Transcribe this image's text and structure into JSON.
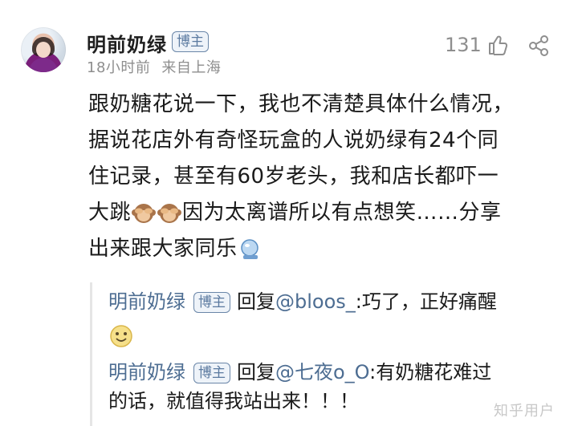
{
  "post": {
    "author": "明前奶绿",
    "author_badge": "博主",
    "time": "18小时前",
    "location": "来自上海",
    "likes": "131",
    "content_lines": [
      "跟奶糖花说一下，我也不清楚具体什么情况，",
      "据说花店外有奇怪玩盒的人说奶绿有24个同",
      "住记录，甚至有60岁老头，我和店长都吓一",
      "因为太离谱所以有点想笑……分享",
      "出来跟大家同乐"
    ],
    "line4_prefix": "大跳"
  },
  "replies": [
    {
      "name": "明前奶绿",
      "badge": "博主",
      "verb": "回复",
      "mention": "@bloos_",
      "text": ":巧了，正好痛醒"
    },
    {
      "name": "明前奶绿",
      "badge": "博主",
      "verb": "回复",
      "mention": "@七夜o_O",
      "text": ":有奶糖花难过",
      "text2": "的话，就值得我站出来！！！"
    }
  ],
  "watermark": "知乎用户",
  "icons": {
    "like": "thumbs-up-icon",
    "share": "share-icon",
    "emoji1": "see-no-evil-monkey-emoji",
    "emoji2": "see-no-evil-monkey-emoji",
    "emoji3": "crystal-ball-emoji",
    "emoji4": "smiling-face-emoji"
  }
}
